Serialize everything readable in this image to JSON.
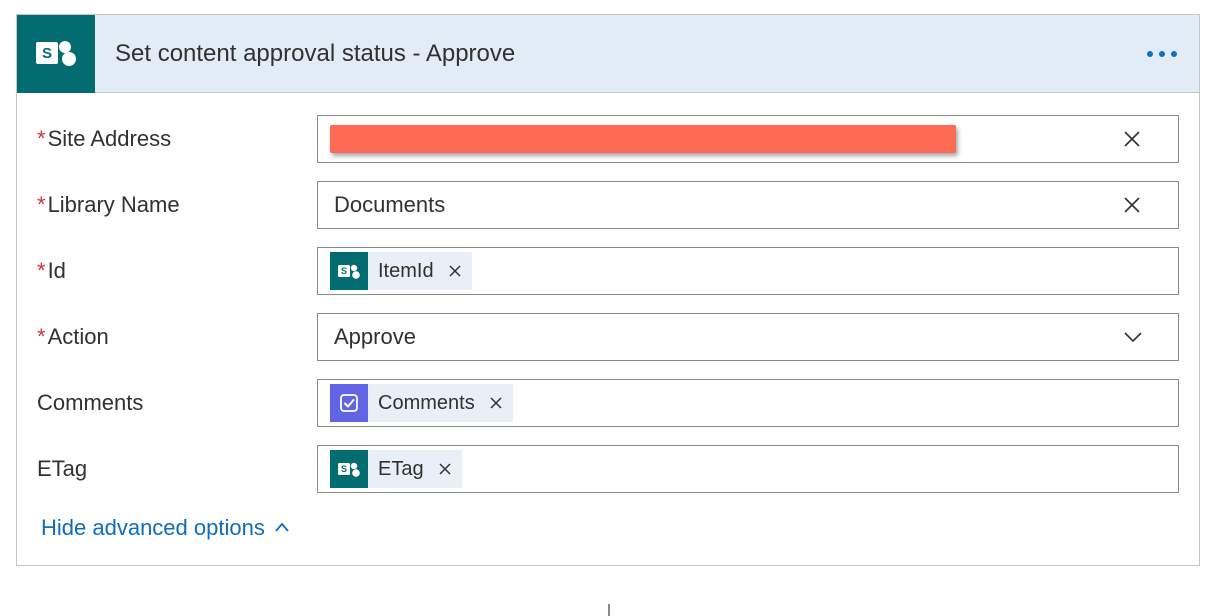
{
  "header": {
    "title": "Set content approval status - Approve",
    "connector": "sharepoint"
  },
  "fields": {
    "siteAddress": {
      "label": "Site Address",
      "required": true,
      "value_redacted": true
    },
    "libraryName": {
      "label": "Library Name",
      "required": true,
      "value": "Documents"
    },
    "id": {
      "label": "Id",
      "required": true,
      "token": {
        "icon": "sharepoint",
        "label": "ItemId"
      }
    },
    "action": {
      "label": "Action",
      "required": true,
      "value": "Approve"
    },
    "comments": {
      "label": "Comments",
      "required": false,
      "token": {
        "icon": "approvals",
        "label": "Comments"
      }
    },
    "etag": {
      "label": "ETag",
      "required": false,
      "token": {
        "icon": "sharepoint",
        "label": "ETag"
      }
    }
  },
  "footer": {
    "toggle_label": "Hide advanced options"
  },
  "icons": {
    "sharepoint": "sharepoint-icon",
    "approvals": "approvals-icon"
  }
}
